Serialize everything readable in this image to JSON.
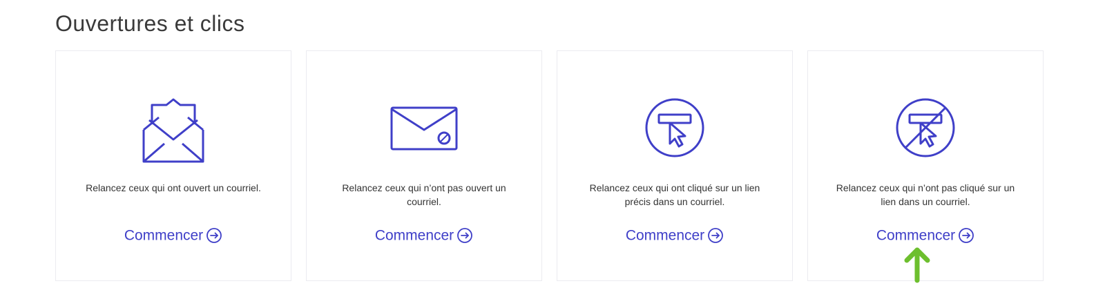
{
  "section": {
    "title": "Ouvertures et clics"
  },
  "cards": [
    {
      "icon": "open-envelope-icon",
      "description": "Relancez ceux qui ont ouvert un courriel.",
      "cta_label": "Commencer"
    },
    {
      "icon": "unopened-envelope-icon",
      "description": "Relancez ceux qui n’ont pas ouvert un courriel.",
      "cta_label": "Commencer"
    },
    {
      "icon": "link-click-icon",
      "description": "Relancez ceux qui ont cliqué sur un lien précis dans un courriel.",
      "cta_label": "Commencer"
    },
    {
      "icon": "no-link-click-icon",
      "description": "Relancez ceux qui n’ont pas cliqué sur un lien dans un courriel.",
      "cta_label": "Commencer"
    }
  ],
  "colors": {
    "accent": "#3f3fc8",
    "text": "#333333",
    "title": "#3a3a3a",
    "card_border": "#ebebf0",
    "annotation": "#6dbf2e"
  }
}
